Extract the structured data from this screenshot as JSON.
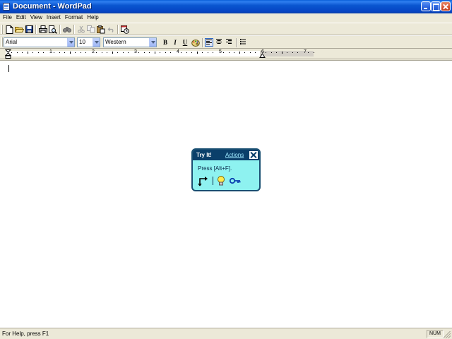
{
  "window": {
    "title": "Document - WordPad"
  },
  "menu": {
    "items": [
      {
        "label": "File"
      },
      {
        "label": "Edit"
      },
      {
        "label": "View"
      },
      {
        "label": "Insert"
      },
      {
        "label": "Format"
      },
      {
        "label": "Help"
      }
    ]
  },
  "toolbar": {
    "buttons": [
      {
        "icon": "new-document-icon"
      },
      {
        "icon": "open-folder-icon"
      },
      {
        "icon": "save-icon"
      },
      {
        "icon": "print-icon"
      },
      {
        "icon": "print-preview-icon"
      },
      {
        "icon": "find-icon"
      },
      {
        "icon": "cut-icon"
      },
      {
        "icon": "copy-icon"
      },
      {
        "icon": "paste-icon"
      },
      {
        "icon": "undo-icon"
      },
      {
        "icon": "insert-date-time-icon"
      }
    ]
  },
  "format_bar": {
    "font": "Arial",
    "size": "10",
    "script": "Western",
    "bold": "B",
    "italic": "I",
    "underline": "U",
    "align_left_pressed": true
  },
  "ruler": {
    "numbers": [
      "1",
      "2",
      "3",
      "4",
      "5",
      "6",
      "7"
    ]
  },
  "popup": {
    "title": "Try It!",
    "actions": "Actions",
    "instruction": "Press [Alt+F]."
  },
  "status": {
    "help": "For Help, press F1",
    "num": "NUM"
  }
}
